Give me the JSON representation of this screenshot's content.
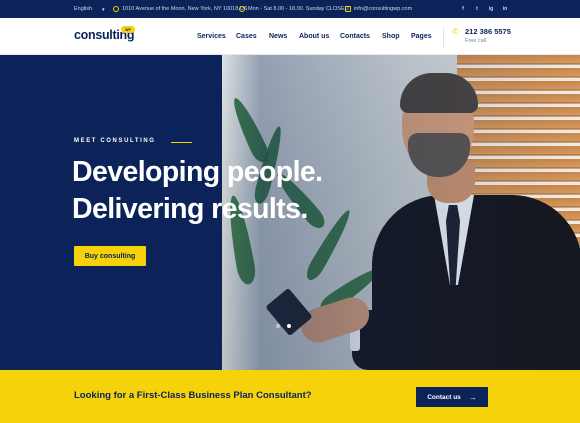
{
  "topbar": {
    "language": "English",
    "address": "1010 Avenue of the Moon, New York, NY 10018 US",
    "hours": "Mon - Sat 8.00 - 18.00. Sunday CLOSED",
    "email": "info@consultingwp.com",
    "social": [
      "f",
      "t",
      "ig",
      "in"
    ]
  },
  "header": {
    "logo": "consulting",
    "logo_badge": "WP",
    "nav": [
      "Services",
      "Cases",
      "News",
      "About us",
      "Contacts",
      "Shop",
      "Pages"
    ],
    "phone": "212 386 5575",
    "phone_note": "Free call"
  },
  "hero": {
    "eyebrow": "MEET CONSULTING",
    "headline_line1": "Developing people.",
    "headline_line2": "Delivering results.",
    "button": "Buy consulting",
    "slides": 2,
    "active_slide": 2
  },
  "cta": {
    "text": "Looking for a First-Class Business Plan Consultant?",
    "button": "Contact us"
  },
  "colors": {
    "navy": "#0b2359",
    "yellow": "#f5d20a"
  }
}
